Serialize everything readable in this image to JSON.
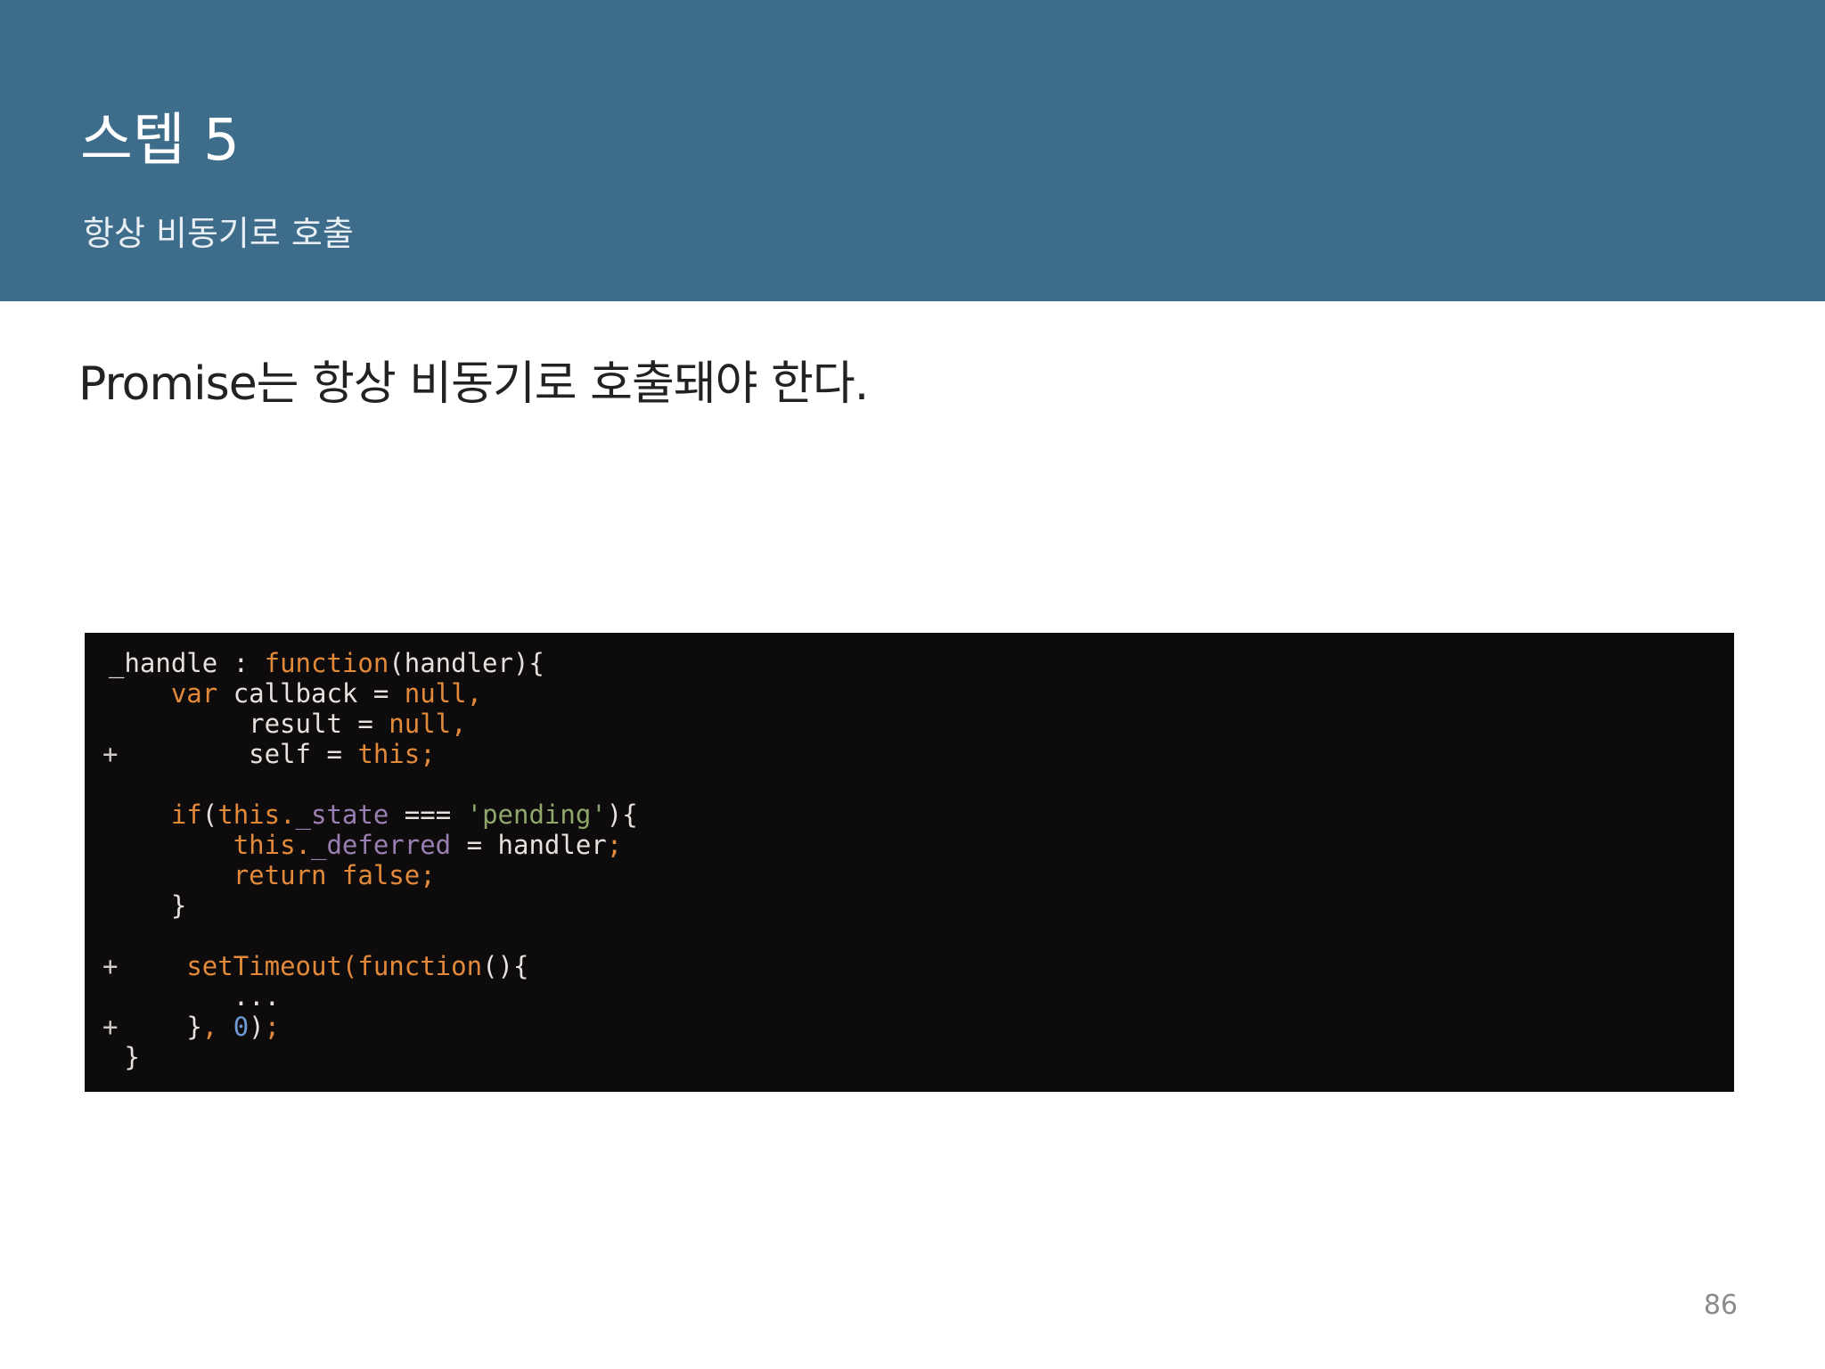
{
  "header": {
    "title": "스텝 5",
    "subtitle": "항상 비동기로 호출"
  },
  "body": {
    "lead": "Promise는 항상 비동기로 호출돼야 한다."
  },
  "code": {
    "lines": [
      {
        "marker": "",
        "indent": "",
        "tokens": [
          [
            "_handle : ",
            "p"
          ],
          [
            "function",
            "kw"
          ],
          [
            "(handler){",
            "p"
          ]
        ]
      },
      {
        "marker": "",
        "indent": "    ",
        "tokens": [
          [
            "var",
            "kw"
          ],
          [
            " callback = ",
            "p"
          ],
          [
            "null,",
            "kw"
          ]
        ]
      },
      {
        "marker": "",
        "indent": "         ",
        "tokens": [
          [
            "result = ",
            "p"
          ],
          [
            "null,",
            "kw"
          ]
        ]
      },
      {
        "marker": "+",
        "indent": "         ",
        "tokens": [
          [
            "self = ",
            "p"
          ],
          [
            "this;",
            "kw"
          ]
        ]
      },
      {
        "marker": "",
        "indent": "",
        "tokens": []
      },
      {
        "marker": "",
        "indent": "    ",
        "tokens": [
          [
            "if",
            "kw"
          ],
          [
            "(",
            "p"
          ],
          [
            "this.",
            "kw"
          ],
          [
            "_state",
            "prop"
          ],
          [
            " === ",
            "p"
          ],
          [
            "'pending'",
            "str"
          ],
          [
            "){",
            "p"
          ]
        ]
      },
      {
        "marker": "",
        "indent": "        ",
        "tokens": [
          [
            "this.",
            "kw"
          ],
          [
            "_deferred",
            "prop"
          ],
          [
            " = handler",
            "p"
          ],
          [
            ";",
            "kw"
          ]
        ]
      },
      {
        "marker": "",
        "indent": "        ",
        "tokens": [
          [
            "return false;",
            "kw"
          ]
        ]
      },
      {
        "marker": "",
        "indent": "    ",
        "tokens": [
          [
            "}",
            "p"
          ]
        ]
      },
      {
        "marker": "",
        "indent": "",
        "tokens": []
      },
      {
        "marker": "+",
        "indent": "     ",
        "tokens": [
          [
            "setTimeout(",
            "kw"
          ],
          [
            "function",
            "kw"
          ],
          [
            "(){",
            "p"
          ]
        ]
      },
      {
        "marker": "",
        "indent": "        ",
        "tokens": [
          [
            "...",
            "p"
          ]
        ]
      },
      {
        "marker": "+",
        "indent": "     ",
        "tokens": [
          [
            "}",
            "p"
          ],
          [
            ", ",
            "kw"
          ],
          [
            "0",
            "num"
          ],
          [
            ")",
            "p"
          ],
          [
            ";",
            "kw"
          ]
        ]
      },
      {
        "marker": "",
        "indent": " ",
        "tokens": [
          [
            "}",
            "p"
          ]
        ]
      }
    ]
  },
  "footer": {
    "page_number": "86"
  },
  "colors": {
    "header_bg": "#3d6d8a",
    "code_bg": "#0d0b0c",
    "keyword": "#e28a3a",
    "string": "#8fa76d",
    "number": "#6c9ad6",
    "property": "#9a7fb2"
  }
}
